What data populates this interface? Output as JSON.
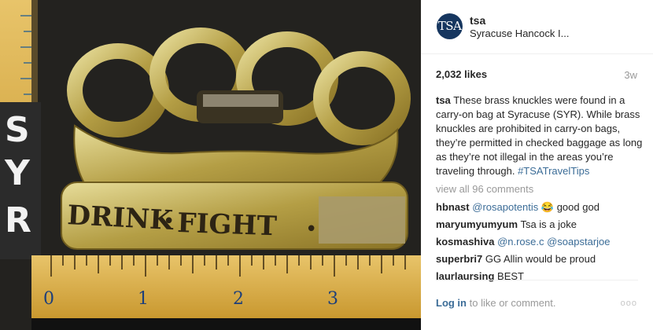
{
  "post": {
    "image_alt": "Brass knuckles engraved DRINK FIGHT on a ruler",
    "engraving_word1": "DRINK",
    "engraving_word2": "FIGHT",
    "sign_letters": [
      "S",
      "Y",
      "R"
    ],
    "ruler_numbers": [
      "0",
      "1",
      "2",
      "3"
    ]
  },
  "header": {
    "avatar_text": "TSA",
    "username": "tsa",
    "location": "Syracuse Hancock I..."
  },
  "stats": {
    "likes": "2,032 likes",
    "age": "3w"
  },
  "caption": {
    "username": "tsa",
    "text": "These brass knuckles were found in a carry-on bag at Syracuse (SYR). While brass knuckles are prohibited in carry-on bags, they’re permitted in checked baggage as long as they’re not illegal in the areas you’re traveling through.",
    "hashtag": "#TSATravelTips"
  },
  "view_all": "view all 96 comments",
  "comments": [
    {
      "user": "hbnast",
      "mention": "@rosapotentis",
      "text": "😂 good god"
    },
    {
      "user": "maryumyumyum",
      "mention": "",
      "text": "Tsa is a joke"
    },
    {
      "user": "kosmashiva",
      "mention": "@n.rose.c @soapstarjoe",
      "text": ""
    },
    {
      "user": "superbri7",
      "mention": "",
      "text": "GG Allin would be proud"
    },
    {
      "user": "laurlaursing",
      "mention": "",
      "text": "BEST"
    }
  ],
  "footer": {
    "login_label": "Log in",
    "suffix": "to like or comment.",
    "more_label": "ooo"
  },
  "colors": {
    "link": "#3b6c97",
    "avatar_bg": "#16365f",
    "muted": "#999999"
  }
}
